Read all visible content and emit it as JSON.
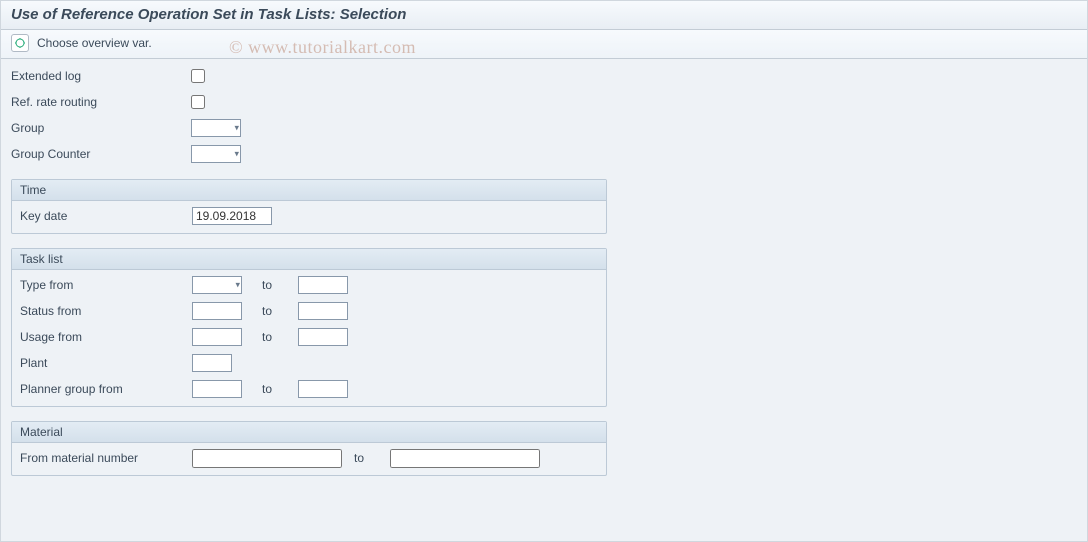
{
  "title": "Use of Reference Operation Set in Task Lists: Selection",
  "toolbar": {
    "choose_overview_label": "Choose overview var."
  },
  "watermark": "© www.tutorialkart.com",
  "top": {
    "extended_log_label": "Extended log",
    "ref_rate_routing_label": "Ref. rate routing",
    "group_label": "Group",
    "group_counter_label": "Group Counter"
  },
  "time": {
    "header": "Time",
    "key_date_label": "Key date",
    "key_date_value": "19.09.2018"
  },
  "tasklist": {
    "header": "Task list",
    "type_from_label": "Type from",
    "status_from_label": "Status from",
    "usage_from_label": "Usage from",
    "plant_label": "Plant",
    "planner_group_from_label": "Planner group from",
    "to_label": "to"
  },
  "material": {
    "header": "Material",
    "from_material_label": "From material number",
    "to_label": "to"
  }
}
